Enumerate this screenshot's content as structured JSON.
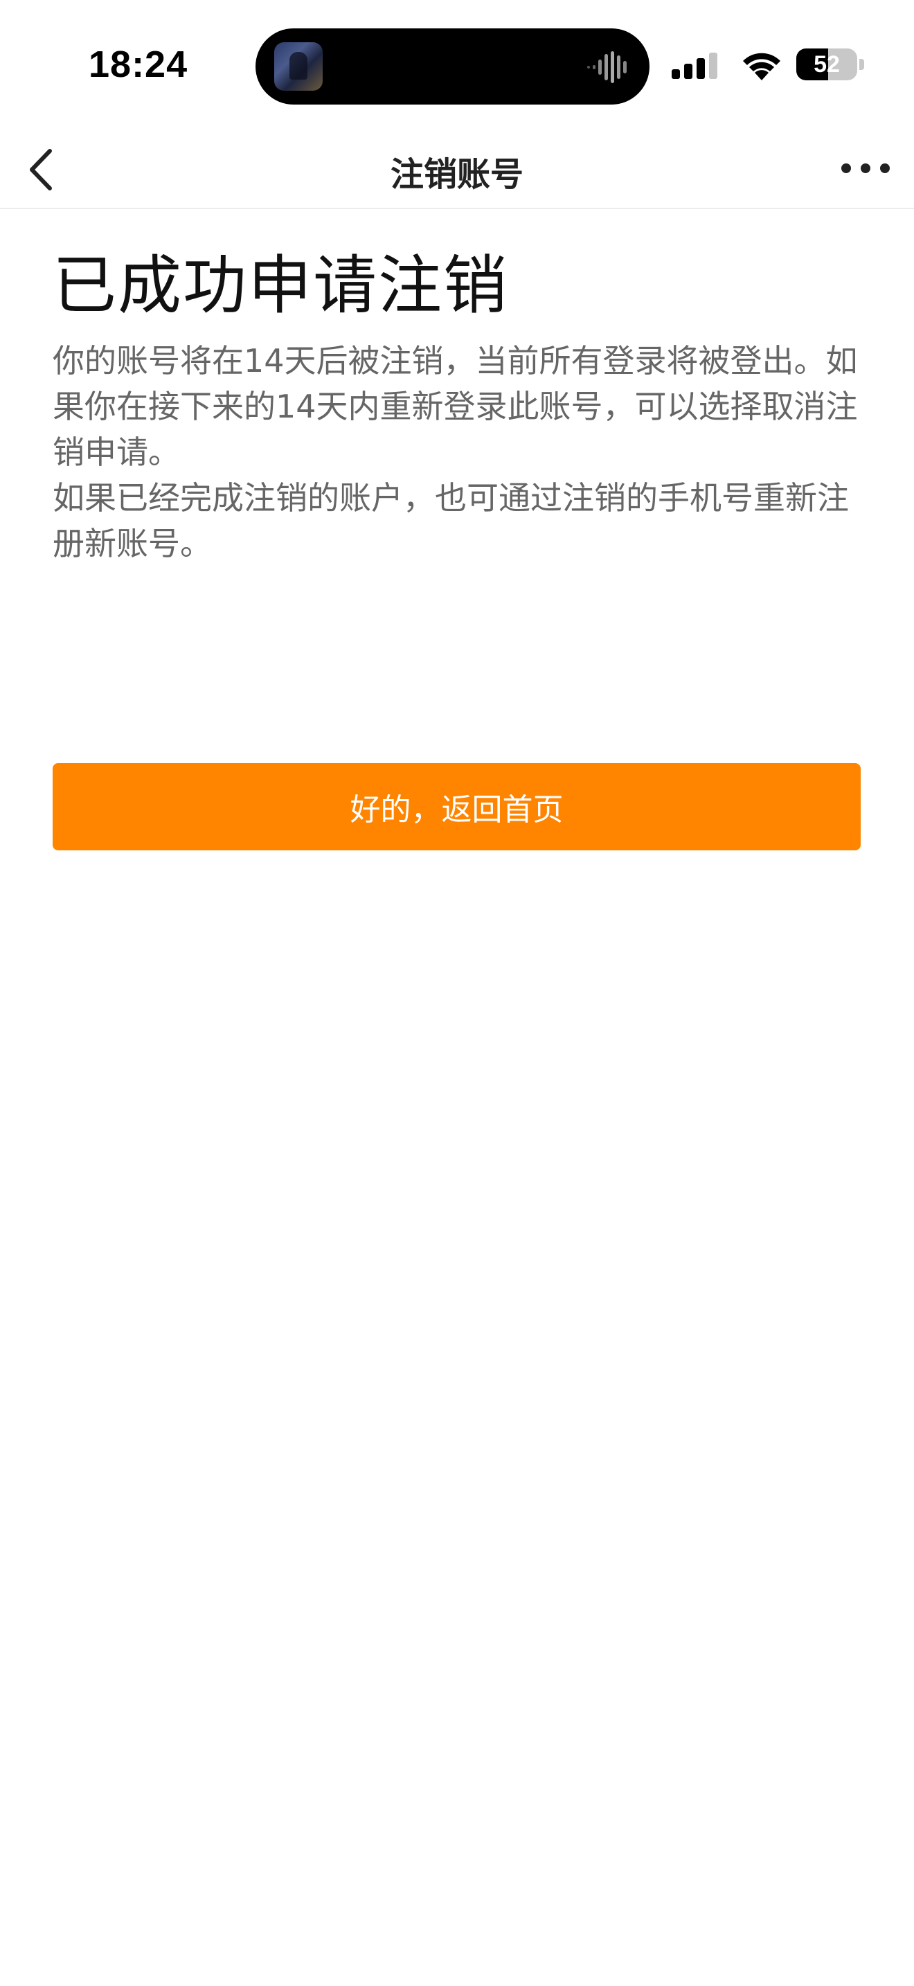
{
  "status_bar": {
    "time": "18:24",
    "battery_level": "52",
    "battery_fraction": 0.52,
    "icons": [
      "cellular-signal-icon",
      "wifi-icon",
      "battery-icon"
    ],
    "island_activity": "now-playing-artwork"
  },
  "nav": {
    "title": "注销账号",
    "back_icon": "chevron-left-icon",
    "more_icon": "more-dots-icon"
  },
  "main": {
    "heading": "已成功申请注销",
    "paragraphs": [
      "你的账号将在14天后被注销，当前所有登录将被登出。如果你在接下来的14天内重新登录此账号，可以选择取消注销申请。",
      "如果已经完成注销的账户，也可通过注销的手机号重新注册新账号。"
    ],
    "button_label": "好的，返回首页"
  },
  "colors": {
    "accent": "#ff8400",
    "heading_text": "#111111",
    "body_text": "#666666",
    "divider": "#ececec"
  }
}
